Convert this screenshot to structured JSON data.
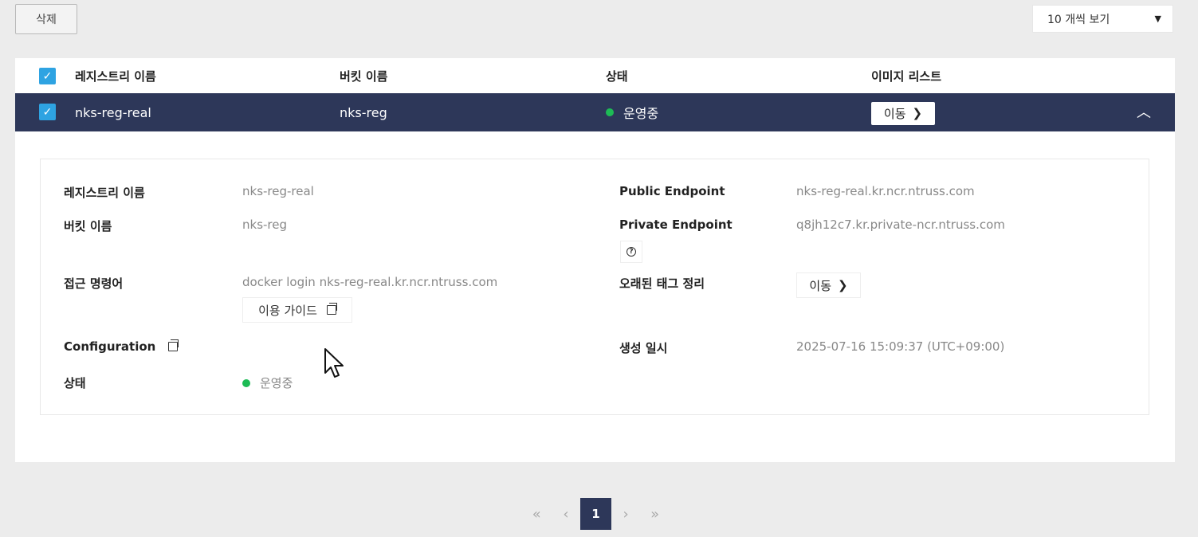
{
  "toolbar": {
    "delete_label": "삭제",
    "page_size_label": "10 개씩 보기",
    "caret": "▼"
  },
  "table": {
    "headers": [
      "레지스트리 이름",
      "버킷 이름",
      "상태",
      "이미지 리스트"
    ],
    "row": {
      "registry_name": "nks-reg-real",
      "bucket_name": "nks-reg",
      "status": "운영중",
      "image_list_button": "이동",
      "chevron": "❯",
      "collapse_icon": "︿"
    },
    "checkmark": "✓"
  },
  "detail": {
    "registry_name_label": "레지스트리 이름",
    "registry_name_value": "nks-reg-real",
    "bucket_name_label": "버킷 이름",
    "bucket_name_value": "nks-reg",
    "access_cmd_label": "접근 명령어",
    "access_cmd_value": "docker login nks-reg-real.kr.ncr.ntruss.com",
    "guide_button": "이용 가이드",
    "configuration_label": "Configuration",
    "status_label": "상태",
    "status_value": "운영중",
    "public_endpoint_label": "Public Endpoint",
    "public_endpoint_value": "nks-reg-real.kr.ncr.ntruss.com",
    "private_endpoint_label": "Private Endpoint",
    "private_endpoint_value": "q8jh12c7.kr.private-ncr.ntruss.com",
    "help_glyph": "?",
    "old_tag_cleanup_label": "오래된 태그 정리",
    "old_tag_cleanup_button": "이동",
    "created_at_label": "생성 일시",
    "created_at_value": "2025-07-16 15:09:37 (UTC+09:00)"
  },
  "pagination": {
    "first": "«",
    "prev": "‹",
    "current": "1",
    "next": "›",
    "last": "»"
  },
  "colors": {
    "header_dark": "#2d3759",
    "checkbox": "#2ea3e2",
    "status_green": "#1dbb55"
  }
}
